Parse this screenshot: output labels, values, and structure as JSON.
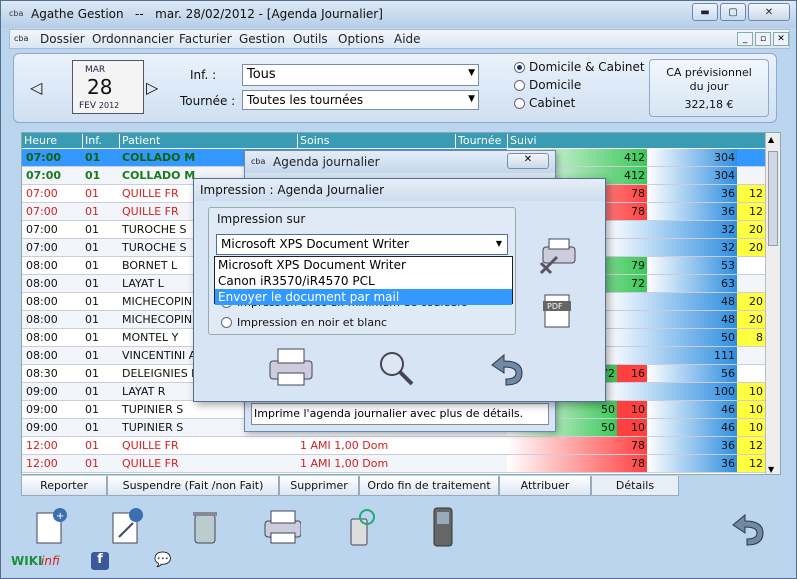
{
  "window": {
    "title": "Agathe Gestion   --   mar. 28/02/2012 - [Agenda Journalier]",
    "app_icon": "cba"
  },
  "menu": [
    "Dossier",
    "Ordonnancier",
    "Facturier",
    "Gestion",
    "Outils",
    "Options",
    "Aide"
  ],
  "calendar": {
    "month_top": "MAR",
    "day": "28",
    "month_bottom": "FEV",
    "year": "2012"
  },
  "filters": {
    "inf_label": "Inf. :",
    "inf_value": "Tous",
    "tournee_label": "Tournée :",
    "tournee_value": "Toutes les tournées"
  },
  "radios": [
    {
      "label": "Domicile & Cabinet",
      "checked": true
    },
    {
      "label": "Domicile",
      "checked": false
    },
    {
      "label": "Cabinet",
      "checked": false
    }
  ],
  "ca": {
    "line1": "CA prévisionnel",
    "line2": "du jour",
    "amount": "322,18 €"
  },
  "grid": {
    "headers": [
      "Heure",
      "Inf.",
      "Patient",
      "Soins",
      "Tournée",
      "Suivi"
    ],
    "rows": [
      {
        "heure": "07:00",
        "inf": "01",
        "patient": "COLLADO M",
        "soins": "",
        "style": "selected",
        "v1": "412",
        "v2": "304",
        "v3": ""
      },
      {
        "heure": "07:00",
        "inf": "01",
        "patient": "COLLADO M",
        "soins": "",
        "style": "green",
        "v1": "412",
        "v2": "304",
        "v3": ""
      },
      {
        "heure": "07:00",
        "inf": "01",
        "patient": "QUILLE FR",
        "soins": "",
        "style": "red",
        "v1": "78",
        "v2": "36",
        "v3": "12"
      },
      {
        "heure": "07:00",
        "inf": "01",
        "patient": "QUILLE FR",
        "soins": "",
        "style": "red",
        "v1": "78",
        "v2": "36",
        "v3": "12"
      },
      {
        "heure": "07:00",
        "inf": "01",
        "patient": "TUROCHE S",
        "soins": "",
        "style": "normal",
        "v1": "",
        "v2": "32",
        "v3": "20"
      },
      {
        "heure": "07:00",
        "inf": "01",
        "patient": "TUROCHE S",
        "soins": "",
        "style": "normal",
        "v1": "",
        "v2": "32",
        "v3": "20"
      },
      {
        "heure": "08:00",
        "inf": "01",
        "patient": "BORNET L",
        "soins": "",
        "style": "normal",
        "v1": "79",
        "v2": "53",
        "v3": ""
      },
      {
        "heure": "08:00",
        "inf": "01",
        "patient": "LAYAT L",
        "soins": "",
        "style": "normal",
        "v1": "72",
        "v2": "63",
        "v3": ""
      },
      {
        "heure": "08:00",
        "inf": "01",
        "patient": "MICHECOPIN T",
        "soins": "",
        "style": "normal",
        "v1": "",
        "v2": "48",
        "v3": "20"
      },
      {
        "heure": "08:00",
        "inf": "01",
        "patient": "MICHECOPIN T",
        "soins": "",
        "style": "normal",
        "v1": "",
        "v2": "48",
        "v3": "20"
      },
      {
        "heure": "08:00",
        "inf": "01",
        "patient": "MONTEL Y",
        "soins": "",
        "style": "normal",
        "v1": "",
        "v2": "50",
        "v3": "8"
      },
      {
        "heure": "08:00",
        "inf": "01",
        "patient": "VINCENTINI A",
        "soins": "",
        "style": "normal",
        "v1": "",
        "v2": "111",
        "v3": ""
      },
      {
        "heure": "08:30",
        "inf": "01",
        "patient": "DELEIGNIES M",
        "soins": "",
        "style": "normal",
        "v1": "72",
        "v1b": "16",
        "v2": "56",
        "v3": ""
      },
      {
        "heure": "09:00",
        "inf": "01",
        "patient": "LAYAT R",
        "soins": "",
        "style": "normal",
        "v1": "",
        "v2": "100",
        "v3": "10"
      },
      {
        "heure": "09:00",
        "inf": "01",
        "patient": "TUPINIER S",
        "soins": "",
        "style": "normal",
        "v1": "50",
        "v1b": "10",
        "v2": "46",
        "v3": "10"
      },
      {
        "heure": "09:00",
        "inf": "01",
        "patient": "TUPINIER S",
        "soins": "",
        "style": "normal",
        "v1": "50",
        "v1b": "10",
        "v2": "46",
        "v3": "10"
      },
      {
        "heure": "12:00",
        "inf": "01",
        "patient": "QUILLE FR",
        "soins": "1 AMI 1,00 Dom",
        "style": "red",
        "v1": "78",
        "v2": "36",
        "v3": "12"
      },
      {
        "heure": "12:00",
        "inf": "01",
        "patient": "QUILLE FR",
        "soins": "1 AMI 1,00 Dom",
        "style": "red",
        "v1": "78",
        "v2": "36",
        "v3": "12"
      }
    ]
  },
  "tabs": [
    "Reporter",
    "Suspendre (Fait /non Fait)",
    "Supprimer",
    "Ordo fin de traitement",
    "Attribuer",
    "Détails"
  ],
  "footer": {
    "wiki": "WIKI",
    "infi": "infi"
  },
  "dialog_back": {
    "title": "Agenda journalier",
    "icon": "cba",
    "close": "✕",
    "description": "Imprime l'agenda journalier avec plus de détails."
  },
  "dialog": {
    "title": "Impression : Agenda Journalier",
    "group_label": "Impression sur",
    "printer_value": "Microsoft XPS Document Writer",
    "printer_options": [
      "Microsoft XPS Document Writer",
      "Canon iR3570/iR4570 PCL",
      "Envoyer le document par mail"
    ],
    "color_option_partial": "Impression avec un minimum de couleurs",
    "bw_option": "Impression en noir et blanc",
    "pdf_label": "PDF"
  }
}
